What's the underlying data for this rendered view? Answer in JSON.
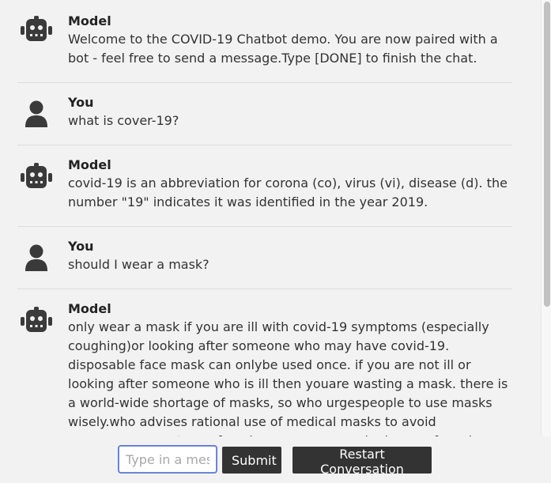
{
  "messages": [
    {
      "role": "bot",
      "author": "Model",
      "text": "Welcome to the COVID-19 Chatbot demo. You are now paired with a bot - feel free to send a message.Type [DONE] to finish the chat."
    },
    {
      "role": "user",
      "author": "You",
      "text": "what is cover-19?"
    },
    {
      "role": "bot",
      "author": "Model",
      "text": "covid-19 is an abbreviation for corona (co), virus (vi), disease (d). the number \"19\" indicates it was identified in the year 2019."
    },
    {
      "role": "user",
      "author": "You",
      "text": "should I wear a mask?"
    },
    {
      "role": "bot",
      "author": "Model",
      "text": "only wear a mask if you are ill with covid-19 symptoms (especially coughing)or looking after someone who may have covid-19. disposable face mask can onlybe used once. if you are not ill or looking after someone who is ill then youare wasting a mask. there is a world-wide shortage of masks, so who urgespeople to use masks wisely.who advises rational use of medical masks to avoid unnecessary wastage ofprecious resources and mis-use of masks (see"
    }
  ],
  "composer": {
    "placeholder": "Type in a message",
    "submit_label": "Submit",
    "restart_label": "Restart Conversation"
  },
  "icons": {
    "bot": "robot-icon",
    "user": "person-icon",
    "color": "#3a3a3a"
  }
}
